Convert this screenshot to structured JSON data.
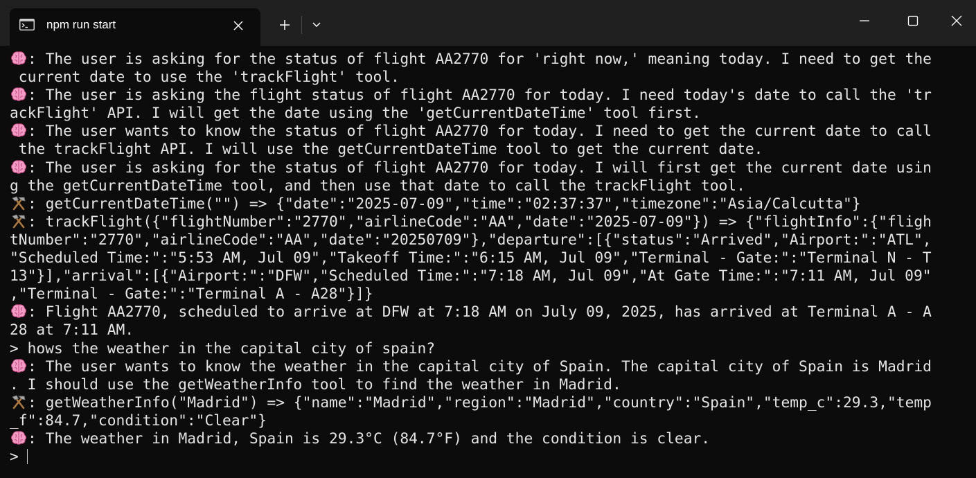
{
  "window": {
    "tab_title": "npm run start",
    "icons": {
      "tab": "terminal-icon",
      "tab_close": "close-icon",
      "new_tab": "plus-icon",
      "dropdown": "chevron-down-icon",
      "minimize": "minimize-icon",
      "maximize": "maximize-icon",
      "close": "close-icon"
    },
    "colors": {
      "titlebar": "#202020",
      "background": "#0c0c0c",
      "text": "#e4e4e4"
    }
  },
  "terminal": {
    "lines": [
      {
        "kind": "thought",
        "text": ": The user is asking for the status of flight AA2770 for 'right now,' meaning today. I need to get the"
      },
      {
        "kind": "plain",
        "text": " current date to use the 'trackFlight' tool."
      },
      {
        "kind": "thought",
        "text": ": The user is asking the flight status of flight AA2770 for today. I need today's date to call the 'tr"
      },
      {
        "kind": "plain",
        "text": "ackFlight' API. I will get the date using the 'getCurrentDateTime' tool first."
      },
      {
        "kind": "thought",
        "text": ": The user wants to know the status of flight AA2770 for today. I need to get the current date to call"
      },
      {
        "kind": "plain",
        "text": " the trackFlight API. I will use the getCurrentDateTime tool to get the current date."
      },
      {
        "kind": "thought",
        "text": ": The user is asking for the status of flight AA2770 for today. I will first get the current date usin"
      },
      {
        "kind": "plain",
        "text": "g the getCurrentDateTime tool, and then use that date to call the trackFlight tool."
      },
      {
        "kind": "tool",
        "text": ": getCurrentDateTime(\"\") => {\"date\":\"2025-07-09\",\"time\":\"02:37:37\",\"timezone\":\"Asia/Calcutta\"}"
      },
      {
        "kind": "tool",
        "text": ": trackFlight({\"flightNumber\":\"2770\",\"airlineCode\":\"AA\",\"date\":\"2025-07-09\"}) => {\"flightInfo\":{\"fligh"
      },
      {
        "kind": "plain",
        "text": "tNumber\":\"2770\",\"airlineCode\":\"AA\",\"date\":\"20250709\"},\"departure\":[{\"status\":\"Arrived\",\"Airport:\":\"ATL\","
      },
      {
        "kind": "plain",
        "text": "\"Scheduled Time:\":\"5:53 AM, Jul 09\",\"Takeoff Time:\":\"6:15 AM, Jul 09\",\"Terminal - Gate:\":\"Terminal N - T"
      },
      {
        "kind": "plain",
        "text": "13\"}],\"arrival\":[{\"Airport:\":\"DFW\",\"Scheduled Time:\":\"7:18 AM, Jul 09\",\"At Gate Time:\":\"7:11 AM, Jul 09\""
      },
      {
        "kind": "plain",
        "text": ",\"Terminal - Gate:\":\"Terminal A - A28\"}]}"
      },
      {
        "kind": "thought",
        "text": ": Flight AA2770, scheduled to arrive at DFW at 7:18 AM on July 09, 2025, has arrived at Terminal A - A"
      },
      {
        "kind": "plain",
        "text": "28 at 7:11 AM."
      },
      {
        "kind": "plain",
        "text": "> hows the weather in the capital city of spain?"
      },
      {
        "kind": "thought",
        "text": ": The user wants to know the weather in the capital city of Spain. The capital city of Spain is Madrid"
      },
      {
        "kind": "plain",
        "text": ". I should use the getWeatherInfo tool to find the weather in Madrid."
      },
      {
        "kind": "tool",
        "text": ": getWeatherInfo(\"Madrid\") => {\"name\":\"Madrid\",\"region\":\"Madrid\",\"country\":\"Spain\",\"temp_c\":29.3,\"temp"
      },
      {
        "kind": "plain",
        "text": "_f\":84.7,\"condition\":\"Clear\"}"
      },
      {
        "kind": "thought",
        "text": ": The weather in Madrid, Spain is 29.3°C (84.7°F) and the condition is clear."
      }
    ],
    "prompt": ">"
  }
}
